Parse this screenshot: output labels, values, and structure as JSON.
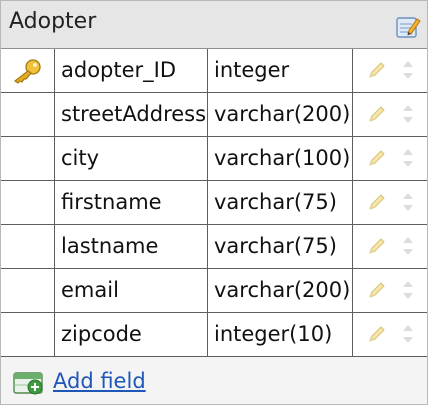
{
  "table": {
    "title": "Adopter",
    "fields": [
      {
        "name": "adopter_ID",
        "type": "integer",
        "primary_key": true
      },
      {
        "name": "streetAddress",
        "type": "varchar(200)",
        "primary_key": false
      },
      {
        "name": "city",
        "type": "varchar(100)",
        "primary_key": false
      },
      {
        "name": "firstname",
        "type": "varchar(75)",
        "primary_key": false
      },
      {
        "name": "lastname",
        "type": "varchar(75)",
        "primary_key": false
      },
      {
        "name": "email",
        "type": "varchar(200)",
        "primary_key": false
      },
      {
        "name": "zipcode",
        "type": "integer(10)",
        "primary_key": false
      }
    ],
    "add_field_label": "Add field"
  },
  "icons": {
    "edit_table": "edit-table-icon",
    "primary_key": "key-icon",
    "edit_field": "pencil-icon",
    "reorder": "up-down-arrows-icon",
    "add_field": "add-field-icon"
  }
}
